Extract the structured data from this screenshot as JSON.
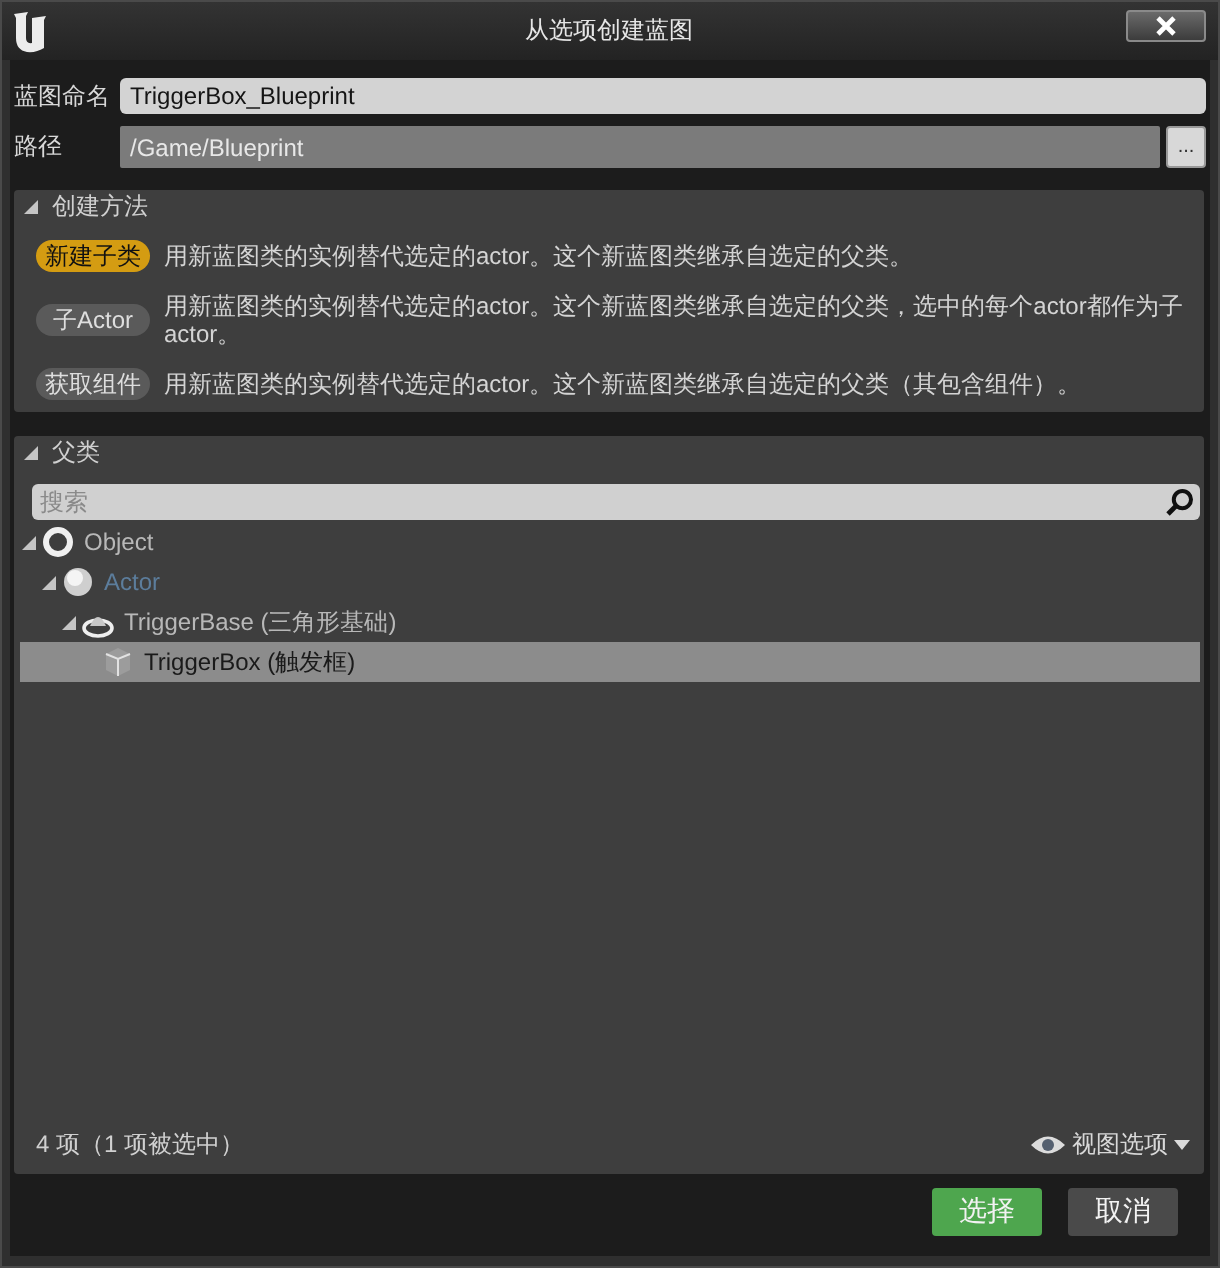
{
  "window": {
    "title": "从选项创建蓝图"
  },
  "fields": [
    {
      "label": "蓝图命名",
      "value": "TriggerBox_Blueprint",
      "kind": "editable"
    },
    {
      "label": "路径",
      "value": "/Game/Blueprint",
      "kind": "readonly",
      "button": "..."
    }
  ],
  "creation_method": {
    "title": "创建方法",
    "expanded": true,
    "options": [
      {
        "label": "新建子类",
        "selected": true,
        "description": "用新蓝图类的实例替代选定的actor。这个新蓝图类继承自选定的父类。"
      },
      {
        "label": "子Actor",
        "selected": false,
        "description": "用新蓝图类的实例替代选定的actor。这个新蓝图类继承自选定的父类，选中的每个actor都作为子actor。"
      },
      {
        "label": "获取组件",
        "selected": false,
        "description": "用新蓝图类的实例替代选定的actor。这个新蓝图类继承自选定的父类（其包含组件）。"
      }
    ]
  },
  "parent_class": {
    "title": "父类",
    "expanded": true,
    "search": {
      "placeholder": "搜索"
    },
    "tree": [
      {
        "label": "Object",
        "kind": "object",
        "selected": false,
        "emphasized": false,
        "expanded": true,
        "children": [
          {
            "label": "Actor",
            "kind": "actor",
            "selected": false,
            "emphasized": true,
            "expanded": true,
            "children": [
              {
                "label": "TriggerBase (三角形基础)",
                "kind": "trigger",
                "selected": false,
                "emphasized": false,
                "expanded": true,
                "children": [
                  {
                    "label": "TriggerBox (触发框)",
                    "kind": "box",
                    "selected": true,
                    "emphasized": false
                  }
                ]
              }
            ]
          }
        ]
      }
    ],
    "status": "4 项（1 项被选中）",
    "view_options": "视图选项"
  },
  "buttons": [
    {
      "label": "选择",
      "kind": "primary"
    },
    {
      "label": "取消",
      "kind": "secondary"
    }
  ]
}
